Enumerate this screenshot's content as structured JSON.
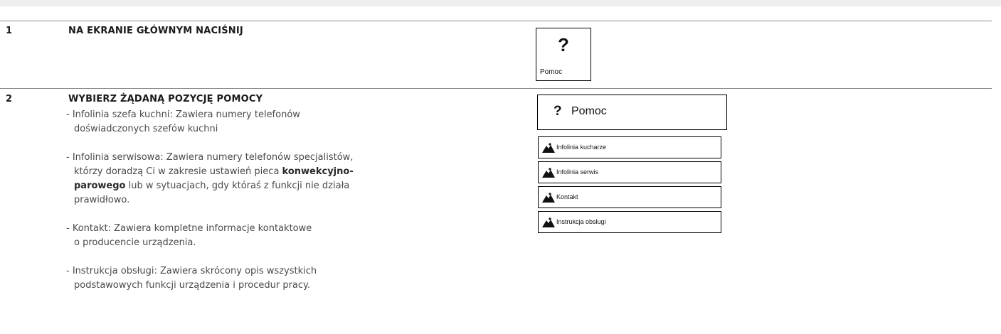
{
  "steps": [
    {
      "number": "1",
      "title": "NA EKRANIE GŁÓWNYM NACIŚNIJ"
    },
    {
      "number": "2",
      "title": "WYBIERZ ŻĄDANĄ POZYCJĘ POMOCY"
    }
  ],
  "items": [
    {
      "lines": [
        "- Infolinia szefa kuchni: Zawiera numery telefonów",
        "doświadczonych szefów kuchni"
      ]
    },
    {
      "line1": "- Infolinia serwisowa: Zawiera numery telefonów specjalistów,",
      "line2_pre": "którzy doradzą Ci w zakresie ustawień pieca ",
      "line2_bold": "konwekcyjno-",
      "line3_bold": "parowego",
      "line3_post": " lub w sytuacjach, gdy któraś z funkcji nie działa",
      "line4": "prawidłowo."
    },
    {
      "lines": [
        "- Kontakt: Zawiera kompletne informacje kontaktowe",
        "o  producencie urządzenia."
      ]
    },
    {
      "lines": [
        "- Instrukcja obsługi: Zawiera skrócony opis wszystkich",
        "podstawowych funkcji urządzenia i procedur pracy."
      ]
    }
  ],
  "help_button": {
    "glyph": "?",
    "label": "Pomoc"
  },
  "help_menu": {
    "glyph": "?",
    "title": "Pomoc",
    "icon": "mountain-icon",
    "entries": [
      "Infolinia kucharze",
      "Infolinia serwis",
      "Kontakt",
      "Instrukcja obsługi"
    ]
  }
}
